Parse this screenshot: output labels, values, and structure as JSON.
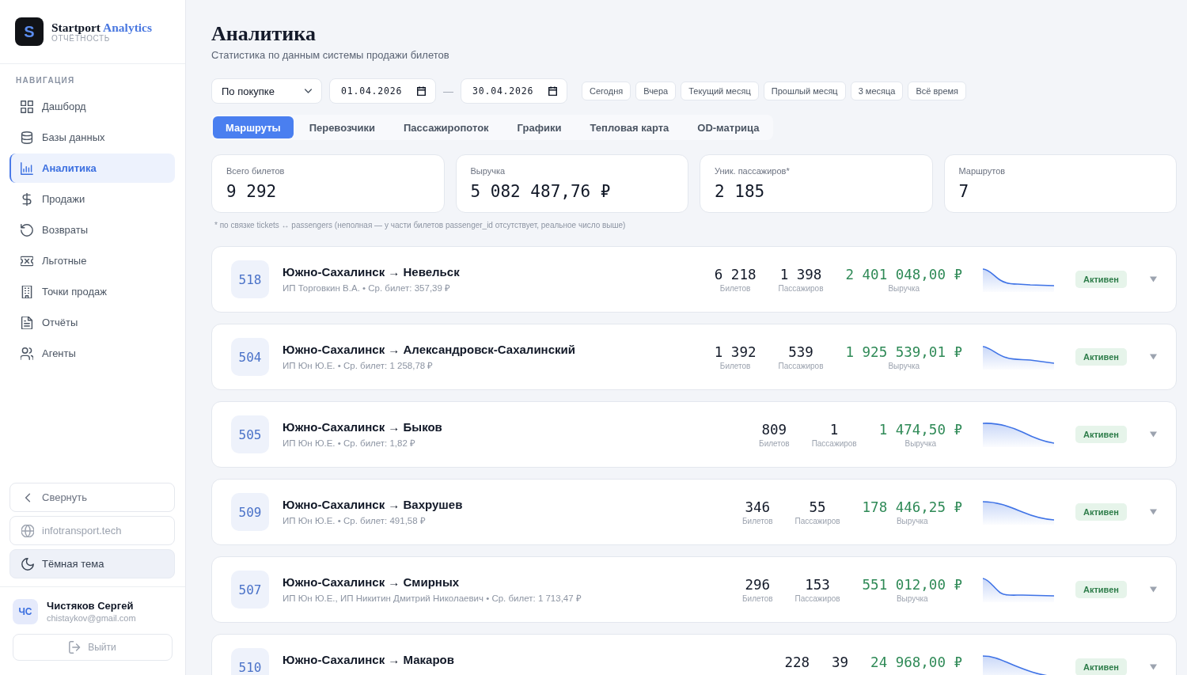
{
  "sidebar": {
    "logo": {
      "letter": "S",
      "brand": "Startport",
      "brand_accent": "Analytics",
      "tagline": "ОТЧЁТНОСТЬ"
    },
    "nav_heading": "НАВИГАЦИЯ",
    "nav_items": [
      {
        "label": "Дашборд",
        "selected": false
      },
      {
        "label": "Базы данных",
        "selected": false
      },
      {
        "label": "Аналитика",
        "selected": true
      },
      {
        "label": "Продажи",
        "selected": false
      },
      {
        "label": "Возвраты",
        "selected": false
      },
      {
        "label": "Льготные",
        "selected": false
      },
      {
        "label": "Точки продаж",
        "selected": false
      },
      {
        "label": "Отчёты",
        "selected": false
      },
      {
        "label": "Агенты",
        "selected": false
      }
    ],
    "footer_buttons": [
      {
        "kind": "button",
        "label": "Свернуть"
      },
      {
        "kind": "link",
        "label": "infotransport.tech"
      },
      {
        "kind": "toggle",
        "label": "Тёмная тема"
      }
    ],
    "user": {
      "initials": "ЧС",
      "name": "Чистяков Сергей",
      "email": "chistaykov@gmail.com",
      "logout": "Выйти"
    }
  },
  "header": {
    "title": "Аналитика",
    "subtitle": "Статистика по данным системы продажи билетов"
  },
  "filters": {
    "mode": "По покупке",
    "date_from": "01.04.2026",
    "separator": "—",
    "date_to": "30.04.2026",
    "presets": [
      "Сегодня",
      "Вчера",
      "Текущий месяц",
      "Прошлый месяц",
      "3 месяца",
      "Всё время"
    ]
  },
  "tabs": [
    {
      "label": "Маршруты",
      "selected": true
    },
    {
      "label": "Перевозчики",
      "selected": false
    },
    {
      "label": "Пассажиропоток",
      "selected": false
    },
    {
      "label": "Графики",
      "selected": false
    },
    {
      "label": "Тепловая карта",
      "selected": false
    },
    {
      "label": "OD-матрица",
      "selected": false
    }
  ],
  "kpis": [
    {
      "label": "Всего билетов",
      "value": "9 292"
    },
    {
      "label": "Выручка",
      "value": "5 082 487,76 ₽"
    },
    {
      "label": "Уник. пассажиров*",
      "value": "2 185"
    },
    {
      "label": "Маршрутов",
      "value": "7"
    }
  ],
  "footnote": "* по связке tickets ↔ passengers (неполная — у части билетов passenger_id отсутствует, реальное число выше)",
  "routes": [
    {
      "code": "518",
      "title": "Южно-Сахалинск → Невельск",
      "subtitle": "ИП Торговкин В.А. • Ср. билет: 357,39 ₽",
      "stats": [
        {
          "kind": "count",
          "value": "6 218",
          "label": "Билетов"
        },
        {
          "kind": "count",
          "value": "1 398",
          "label": "Пассажиров"
        },
        {
          "kind": "money",
          "value": "2 401 048,00 ₽",
          "label": "Выручка"
        }
      ],
      "status": "Активен"
    },
    {
      "code": "504",
      "title": "Южно-Сахалинск → Александровск-Сахалинский",
      "subtitle": "ИП Юн Ю.Е. • Ср. билет: 1 258,78 ₽",
      "stats": [
        {
          "kind": "count",
          "value": "1 392",
          "label": "Билетов"
        },
        {
          "kind": "count",
          "value": "539",
          "label": "Пассажиров"
        },
        {
          "kind": "money",
          "value": "1 925 539,01 ₽",
          "label": "Выручка"
        }
      ],
      "status": "Активен"
    },
    {
      "code": "505",
      "title": "Южно-Сахалинск → Быков",
      "subtitle": "ИП Юн Ю.Е. • Ср. билет: 1,82 ₽",
      "stats": [
        {
          "kind": "count",
          "value": "809",
          "label": "Билетов"
        },
        {
          "kind": "count",
          "value": "1",
          "label": "Пассажиров"
        },
        {
          "kind": "money",
          "value": "1 474,50 ₽",
          "label": "Выручка"
        }
      ],
      "status": "Активен"
    },
    {
      "code": "509",
      "title": "Южно-Сахалинск → Вахрушев",
      "subtitle": "ИП Юн Ю.Е. • Ср. билет: 491,58 ₽",
      "stats": [
        {
          "kind": "count",
          "value": "346",
          "label": "Билетов"
        },
        {
          "kind": "count",
          "value": "55",
          "label": "Пассажиров"
        },
        {
          "kind": "money",
          "value": "178 446,25 ₽",
          "label": "Выручка"
        }
      ],
      "status": "Активен"
    },
    {
      "code": "507",
      "title": "Южно-Сахалинск → Смирных",
      "subtitle": "ИП Юн Ю.Е., ИП Никитин Дмитрий Николаевич • Ср. билет: 1 713,47 ₽",
      "stats": [
        {
          "kind": "count",
          "value": "296",
          "label": "Билетов"
        },
        {
          "kind": "count",
          "value": "153",
          "label": "Пассажиров"
        },
        {
          "kind": "money",
          "value": "551 012,00 ₽",
          "label": "Выручка"
        }
      ],
      "status": "Активен"
    },
    {
      "code": "510",
      "title": "Южно-Сахалинск → Макаров",
      "stats": [
        {
          "kind": "count",
          "value": "228"
        },
        {
          "kind": "count",
          "value": "39"
        },
        {
          "kind": "money",
          "value": "24 968,00 ₽"
        }
      ],
      "status": "Активен"
    }
  ]
}
